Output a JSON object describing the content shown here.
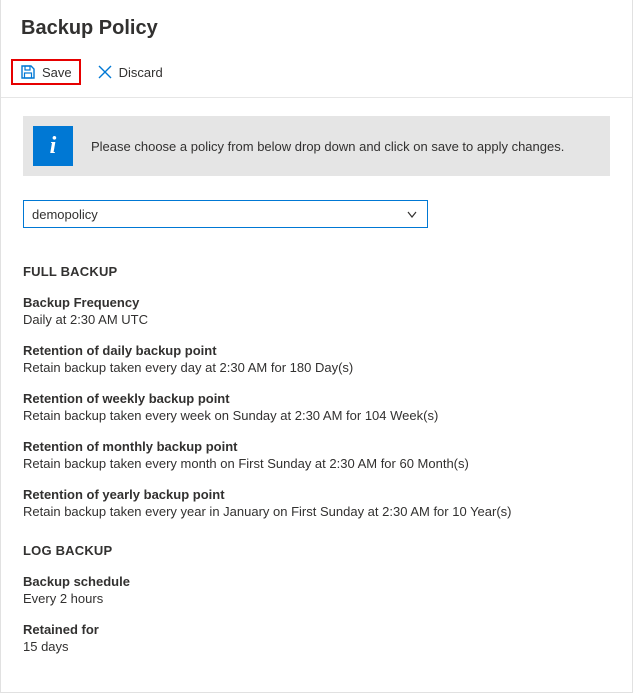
{
  "header": {
    "title": "Backup Policy"
  },
  "toolbar": {
    "save_label": "Save",
    "discard_label": "Discard"
  },
  "banner": {
    "text": "Please choose a policy from below drop down and click on save to apply changes."
  },
  "policy_select": {
    "value": "demopolicy"
  },
  "full_backup": {
    "heading": "FULL BACKUP",
    "frequency": {
      "label": "Backup Frequency",
      "value": "Daily at 2:30 AM UTC"
    },
    "daily_retention": {
      "label": "Retention of daily backup point",
      "value": "Retain backup taken every day at 2:30 AM for 180 Day(s)"
    },
    "weekly_retention": {
      "label": "Retention of weekly backup point",
      "value": "Retain backup taken every week on Sunday at 2:30 AM for 104 Week(s)"
    },
    "monthly_retention": {
      "label": "Retention of monthly backup point",
      "value": "Retain backup taken every month on First Sunday at 2:30 AM for 60 Month(s)"
    },
    "yearly_retention": {
      "label": "Retention of yearly backup point",
      "value": "Retain backup taken every year in January on First Sunday at 2:30 AM for 10 Year(s)"
    }
  },
  "log_backup": {
    "heading": "LOG BACKUP",
    "schedule": {
      "label": "Backup schedule",
      "value": "Every 2 hours"
    },
    "retained": {
      "label": "Retained for",
      "value": "15 days"
    }
  }
}
